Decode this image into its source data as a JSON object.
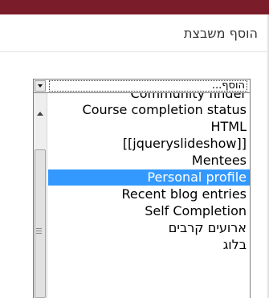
{
  "block": {
    "title": "הוסף משבצת"
  },
  "select": {
    "value": "הוסף..."
  },
  "options": [
    {
      "label": "Community finder",
      "selected": false
    },
    {
      "label": "Course completion status",
      "selected": false
    },
    {
      "label": "HTML",
      "selected": false
    },
    {
      "label": "[[jqueryslideshow]]",
      "selected": false
    },
    {
      "label": "Mentees",
      "selected": false
    },
    {
      "label": "Personal profile",
      "selected": true
    },
    {
      "label": "Recent blog entries",
      "selected": false
    },
    {
      "label": "Self Completion",
      "selected": false
    },
    {
      "label": "ארועים קרבים",
      "selected": false
    },
    {
      "label": "בלוג",
      "selected": false
    }
  ],
  "colors": {
    "top_bar": "#7b1c2a",
    "selection": "#3399ff"
  },
  "icons": {
    "dropdown": "chevron-down-icon",
    "scroll_up": "chevron-up-icon"
  }
}
